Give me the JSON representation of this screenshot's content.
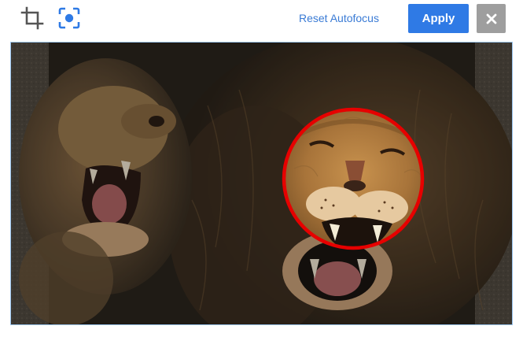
{
  "toolbar": {
    "crop_icon": "crop-icon",
    "focus_icon": "focus-point-icon",
    "reset_label": "Reset Autofocus",
    "apply_label": "Apply",
    "close_icon": "close-icon",
    "close_glyph": "✕"
  },
  "editor": {
    "image_subject": "lion-and-lioness-roaring",
    "focus_marker_color": "#e60000",
    "accent_color": "#2f7ae5",
    "frame_border_color": "#9cc6f0"
  }
}
